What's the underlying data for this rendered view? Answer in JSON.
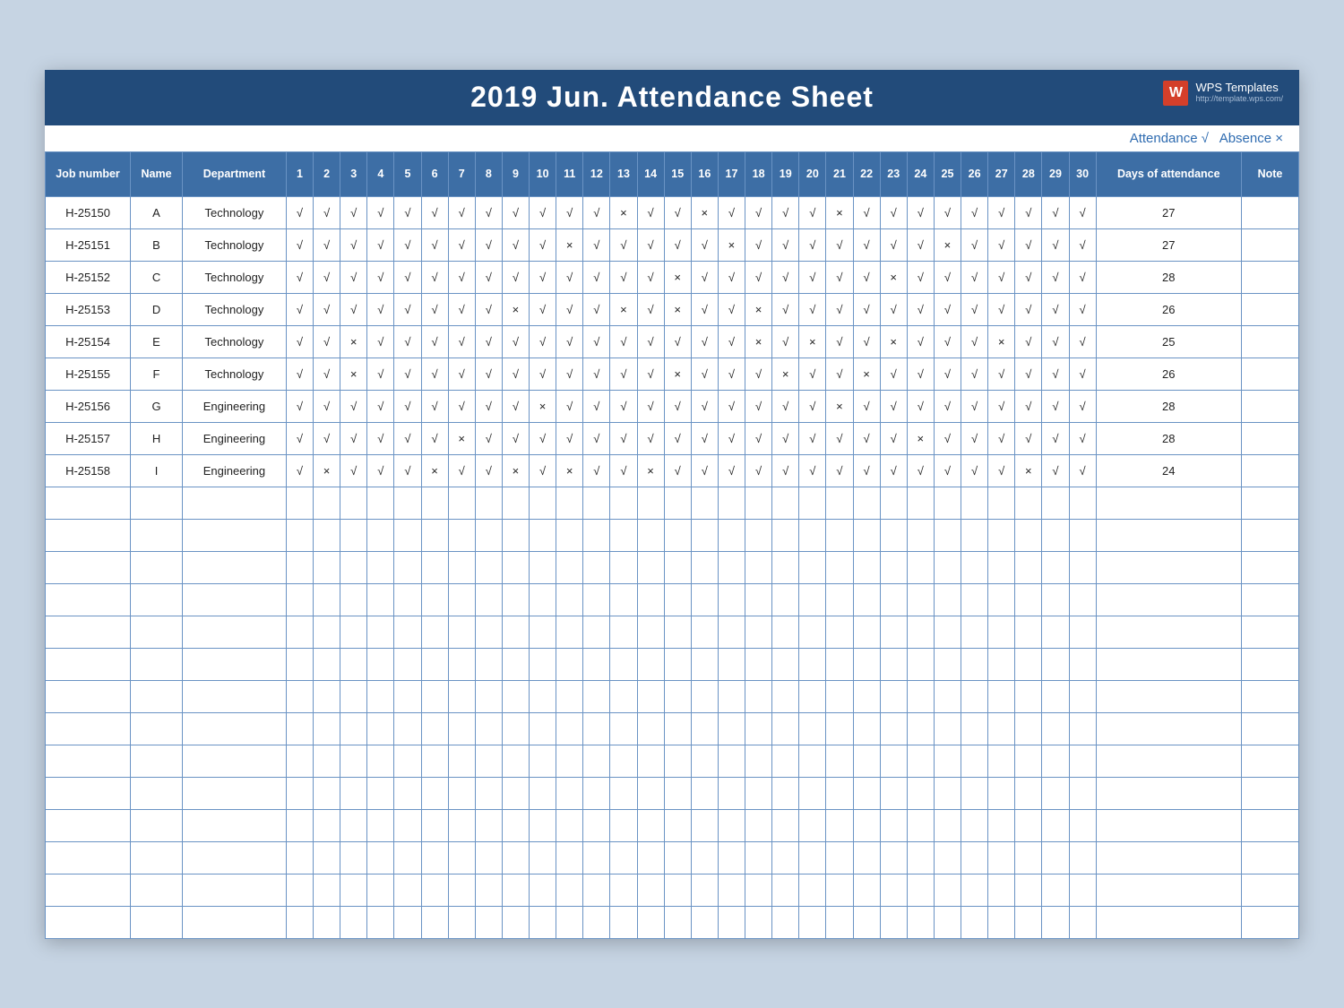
{
  "header": {
    "title": "2019 Jun.  Attendance Sheet",
    "wps_label": "WPS Templates",
    "wps_url_text": "http://template.wps.com/",
    "wps_icon_letter": "W"
  },
  "legend": {
    "attendance_label": "Attendance",
    "attendance_mark": "√",
    "absence_label": "Absence",
    "absence_mark": "×"
  },
  "columns": {
    "job_number": "Job number",
    "name": "Name",
    "department": "Department",
    "days_of_attendance": "Days of attendance",
    "note": "Note"
  },
  "day_count": 30,
  "marks": {
    "present": "√",
    "absent": "×"
  },
  "rows": [
    {
      "job": "H-25150",
      "name": "A",
      "dept": "Technology",
      "days": [
        "√",
        "√",
        "√",
        "√",
        "√",
        "√",
        "√",
        "√",
        "√",
        "√",
        "√",
        "√",
        "×",
        "√",
        "√",
        "×",
        "√",
        "√",
        "√",
        "√",
        "×",
        "√",
        "√",
        "√",
        "√",
        "√",
        "√",
        "√",
        "√",
        "√"
      ],
      "total": 27,
      "note": ""
    },
    {
      "job": "H-25151",
      "name": "B",
      "dept": "Technology",
      "days": [
        "√",
        "√",
        "√",
        "√",
        "√",
        "√",
        "√",
        "√",
        "√",
        "√",
        "×",
        "√",
        "√",
        "√",
        "√",
        "√",
        "×",
        "√",
        "√",
        "√",
        "√",
        "√",
        "√",
        "√",
        "×",
        "√",
        "√",
        "√",
        "√",
        "√"
      ],
      "total": 27,
      "note": ""
    },
    {
      "job": "H-25152",
      "name": "C",
      "dept": "Technology",
      "days": [
        "√",
        "√",
        "√",
        "√",
        "√",
        "√",
        "√",
        "√",
        "√",
        "√",
        "√",
        "√",
        "√",
        "√",
        "×",
        "√",
        "√",
        "√",
        "√",
        "√",
        "√",
        "√",
        "×",
        "√",
        "√",
        "√",
        "√",
        "√",
        "√",
        "√"
      ],
      "total": 28,
      "note": ""
    },
    {
      "job": "H-25153",
      "name": "D",
      "dept": "Technology",
      "days": [
        "√",
        "√",
        "√",
        "√",
        "√",
        "√",
        "√",
        "√",
        "×",
        "√",
        "√",
        "√",
        "×",
        "√",
        "×",
        "√",
        "√",
        "×",
        "√",
        "√",
        "√",
        "√",
        "√",
        "√",
        "√",
        "√",
        "√",
        "√",
        "√",
        "√"
      ],
      "total": 26,
      "note": ""
    },
    {
      "job": "H-25154",
      "name": "E",
      "dept": "Technology",
      "days": [
        "√",
        "√",
        "×",
        "√",
        "√",
        "√",
        "√",
        "√",
        "√",
        "√",
        "√",
        "√",
        "√",
        "√",
        "√",
        "√",
        "√",
        "×",
        "√",
        "×",
        "√",
        "√",
        "×",
        "√",
        "√",
        "√",
        "×",
        "√",
        "√",
        "√"
      ],
      "total": 25,
      "note": ""
    },
    {
      "job": "H-25155",
      "name": "F",
      "dept": "Technology",
      "days": [
        "√",
        "√",
        "×",
        "√",
        "√",
        "√",
        "√",
        "√",
        "√",
        "√",
        "√",
        "√",
        "√",
        "√",
        "×",
        "√",
        "√",
        "√",
        "×",
        "√",
        "√",
        "×",
        "√",
        "√",
        "√",
        "√",
        "√",
        "√",
        "√",
        "√"
      ],
      "total": 26,
      "note": ""
    },
    {
      "job": "H-25156",
      "name": "G",
      "dept": "Engineering",
      "days": [
        "√",
        "√",
        "√",
        "√",
        "√",
        "√",
        "√",
        "√",
        "√",
        "×",
        "√",
        "√",
        "√",
        "√",
        "√",
        "√",
        "√",
        "√",
        "√",
        "√",
        "×",
        "√",
        "√",
        "√",
        "√",
        "√",
        "√",
        "√",
        "√",
        "√"
      ],
      "total": 28,
      "note": ""
    },
    {
      "job": "H-25157",
      "name": "H",
      "dept": "Engineering",
      "days": [
        "√",
        "√",
        "√",
        "√",
        "√",
        "√",
        "×",
        "√",
        "√",
        "√",
        "√",
        "√",
        "√",
        "√",
        "√",
        "√",
        "√",
        "√",
        "√",
        "√",
        "√",
        "√",
        "√",
        "×",
        "√",
        "√",
        "√",
        "√",
        "√",
        "√"
      ],
      "total": 28,
      "note": ""
    },
    {
      "job": "H-25158",
      "name": "I",
      "dept": "Engineering",
      "days": [
        "√",
        "×",
        "√",
        "√",
        "√",
        "×",
        "√",
        "√",
        "×",
        "√",
        "×",
        "√",
        "√",
        "×",
        "√",
        "√",
        "√",
        "√",
        "√",
        "√",
        "√",
        "√",
        "√",
        "√",
        "√",
        "√",
        "√",
        "×",
        "√",
        "√"
      ],
      "total": 24,
      "note": ""
    }
  ],
  "empty_rows": 14
}
